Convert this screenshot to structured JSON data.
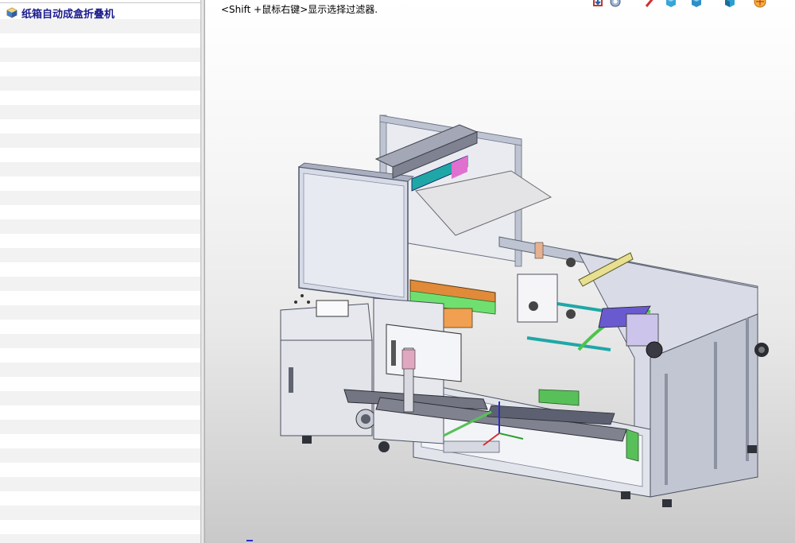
{
  "tree": {
    "root_label": "纸箱自动成盒折叠机",
    "root_icon": "assembly-icon"
  },
  "viewport": {
    "hint_text": "<Shift +鼠标右键>显示选择过滤器.",
    "model_name": "carton-forming-machine-model"
  },
  "heads_up_toolbar": {
    "buttons": [
      {
        "name": "previous-view-icon"
      },
      {
        "name": "view-settings-icon"
      },
      {
        "name": "section-view-icon"
      },
      {
        "name": "view-orientation-icon"
      },
      {
        "name": "display-style-icon"
      },
      {
        "name": "hide-show-items-icon"
      },
      {
        "name": "apply-scene-icon"
      }
    ]
  },
  "colors": {
    "tree_label": "#1a1a8c",
    "frame": "#bfc4d2",
    "frame_dark": "#6d7384",
    "accent_teal": "#1fa7a7",
    "accent_orange": "#e08a3a",
    "accent_green": "#4cc44c",
    "accent_pink": "#e070d0",
    "accent_yellow": "#e8e090"
  }
}
